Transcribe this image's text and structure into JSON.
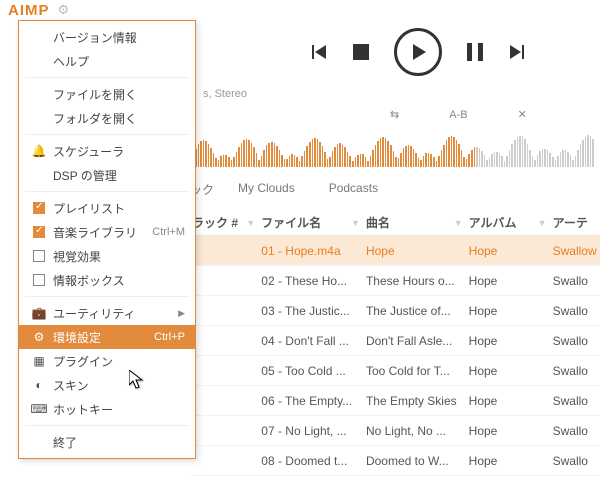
{
  "app": {
    "name": "AIMP"
  },
  "info_line": "s, Stereo",
  "tools": {
    "ab": "A-B"
  },
  "tabs": {
    "t1": "ック",
    "t2": "My Clouds",
    "t3": "Podcasts"
  },
  "columns": {
    "track": "ラック #",
    "file": "ファイル名",
    "title": "曲名",
    "album": "アルバム",
    "artist": "アーテ"
  },
  "rows": [
    {
      "file": "01 - Hope.m4a",
      "title": "Hope",
      "album": "Hope",
      "artist": "Swallow"
    },
    {
      "file": "02 - These Ho...",
      "title": "These Hours o...",
      "album": "Hope",
      "artist": "Swallo"
    },
    {
      "file": "03 - The Justic...",
      "title": "The Justice of...",
      "album": "Hope",
      "artist": "Swallo"
    },
    {
      "file": "04 - Don't Fall ...",
      "title": "Don't Fall Asle...",
      "album": "Hope",
      "artist": "Swallo"
    },
    {
      "file": "05 - Too Cold ...",
      "title": "Too Cold for T...",
      "album": "Hope",
      "artist": "Swallo"
    },
    {
      "file": "06 - The Empty...",
      "title": "The Empty Skies",
      "album": "Hope",
      "artist": "Swallo"
    },
    {
      "file": "07 - No Light, ...",
      "title": "No Light, No ...",
      "album": "Hope",
      "artist": "Swallo"
    },
    {
      "file": "08 - Doomed t...",
      "title": "Doomed to W...",
      "album": "Hope",
      "artist": "Swallo"
    }
  ],
  "menu": {
    "version": "バージョン情報",
    "help": "ヘルプ",
    "open_file": "ファイルを開く",
    "open_folder": "フォルダを開く",
    "scheduler": "スケジューラ",
    "dsp": "DSP の管理",
    "playlist": "プレイリスト",
    "library": "音楽ライブラリ",
    "library_hint": "Ctrl+M",
    "visual": "視覚効果",
    "infobox": "情報ボックス",
    "utility": "ユーティリティ",
    "prefs": "環境設定",
    "prefs_hint": "Ctrl+P",
    "plugin": "プラグイン",
    "skin": "スキン",
    "hotkey": "ホットキー",
    "exit": "終了"
  }
}
